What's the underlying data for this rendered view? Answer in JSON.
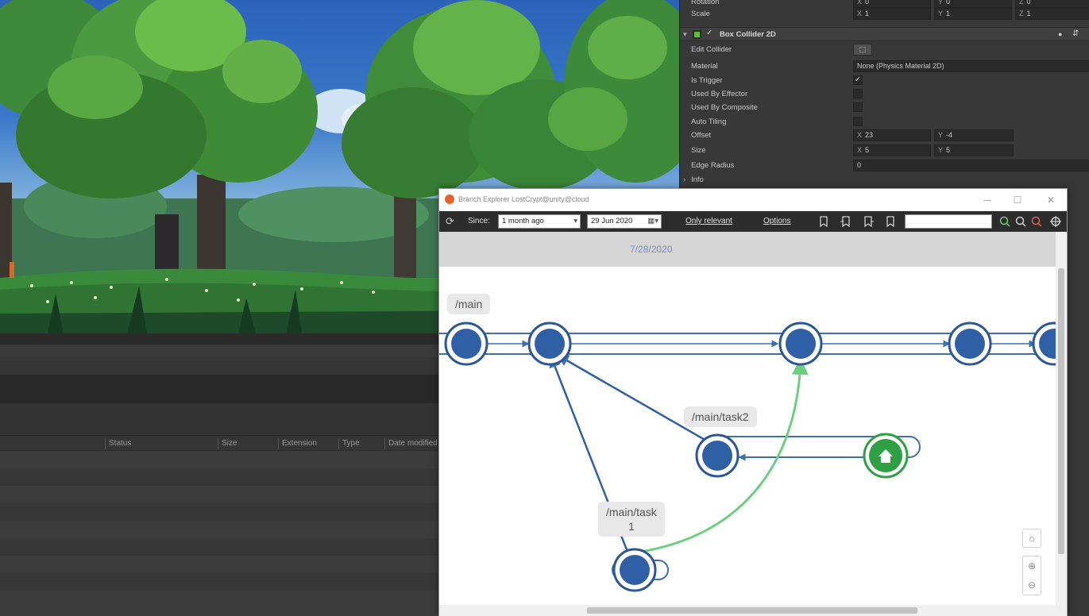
{
  "inspector": {
    "transform_rows": [
      {
        "label": "Rotation",
        "x": "0",
        "y": "0",
        "z": "0"
      },
      {
        "label": "Scale",
        "x": "1",
        "y": "1",
        "z": "1"
      }
    ],
    "component_title": "Box Collider 2D",
    "edit_collider": "Edit Collider",
    "material": {
      "label": "Material",
      "value": "None (Physics Material 2D)"
    },
    "is_trigger": {
      "label": "Is Trigger",
      "checked": true
    },
    "used_by_effector": {
      "label": "Used By Effector",
      "checked": false
    },
    "used_by_composite": {
      "label": "Used By Composite",
      "checked": false
    },
    "auto_tiling": {
      "label": "Auto Tiling",
      "checked": false
    },
    "offset": {
      "label": "Offset",
      "x": "23",
      "y": "-4"
    },
    "size": {
      "label": "Size",
      "x": "5",
      "y": "5"
    },
    "edge_radius": {
      "label": "Edge Radius",
      "value": "0"
    },
    "info": "Info"
  },
  "project": {
    "columns": [
      "Status",
      "Size",
      "Extension",
      "Type",
      "Date modified"
    ]
  },
  "branch_explorer": {
    "window_title": "Branch Explorer LostCrypt@unity@cloud",
    "toolbar": {
      "since_label": "Since:",
      "since_value": "1 month ago",
      "date_value": "29 Jun 2020",
      "only_relevant": "Only relevant",
      "options": "Options",
      "search_value": ""
    },
    "date_header": "7/28/2020",
    "branches": [
      {
        "name": "/main"
      },
      {
        "name": "/main/task2"
      },
      {
        "name_line1": "/main/task",
        "name_line2": "1"
      }
    ],
    "colors": {
      "changeset": "#2f5fa5",
      "changeset_ring": "#2b5797",
      "branch_line": "#3f6fae",
      "merge_green": "#6ccf80",
      "home_green": "#2ea043"
    },
    "icons": [
      "refresh-icon",
      "calendar-icon",
      "bookmark-icon",
      "search-icon",
      "home-icon",
      "zoom-in-icon",
      "zoom-out-icon"
    ]
  }
}
